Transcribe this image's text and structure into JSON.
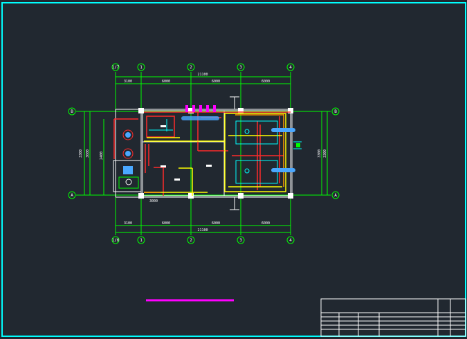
{
  "drawing": {
    "grid_axes_top": [
      "1/7",
      "1",
      "2",
      "3",
      "4"
    ],
    "grid_axes_bottom": [
      "1/6",
      "1",
      "2",
      "3",
      "4"
    ],
    "grid_axes_left": [
      "B",
      "A"
    ],
    "grid_axes_right": [
      "B",
      "A"
    ],
    "dims_top_overall": "21100",
    "dims_top": [
      "3100",
      "6000",
      "6000",
      "6000"
    ],
    "dims_bottom": [
      "3100",
      "6000",
      "6000",
      "6000"
    ],
    "dims_bottom_overall": "21100",
    "dims_left": [
      "3300",
      "3600"
    ],
    "dims_right": [
      "3300",
      "3300"
    ],
    "dim_inner_left": "2400",
    "dim_bottom_local": "3000"
  },
  "colors": {
    "background": "#212830",
    "frame": "#00ffff",
    "grid": "#00ff00",
    "wall": "#ffffff",
    "pipe_red": "#ff2a2a",
    "pipe_yellow": "#ffff00",
    "pipe_orange": "#ff9900",
    "pipe_cyan": "#00ffff",
    "pipe_magenta": "#ff00ff",
    "equipment": "#4aa8ff"
  }
}
